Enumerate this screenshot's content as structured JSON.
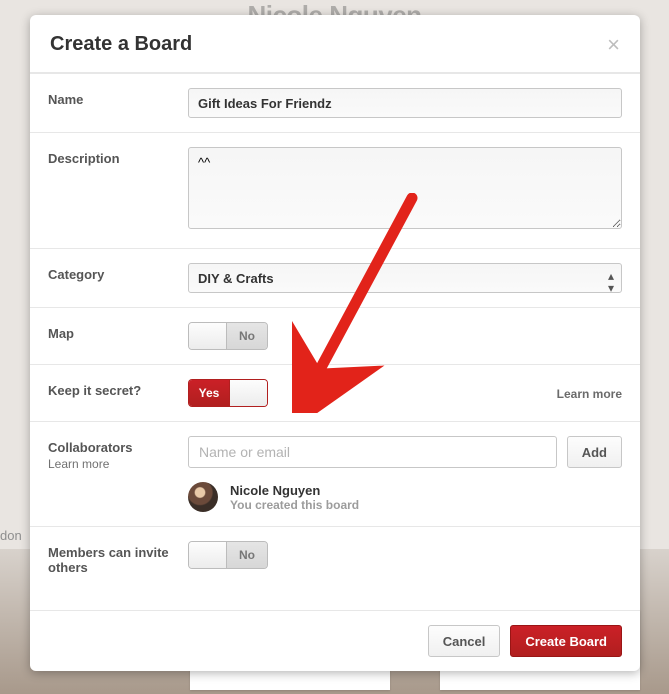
{
  "bg": {
    "name_peek": "Nicole Nguyen",
    "don": "don"
  },
  "modal": {
    "title": "Create a Board",
    "name": {
      "label": "Name",
      "value": "Gift Ideas For Friendz"
    },
    "description": {
      "label": "Description",
      "value": "^^"
    },
    "category": {
      "label": "Category",
      "value": "DIY & Crafts"
    },
    "map": {
      "label": "Map",
      "state_label": "No"
    },
    "secret": {
      "label": "Keep it secret?",
      "state_label": "Yes",
      "learn_more": "Learn more"
    },
    "collaborators": {
      "label": "Collaborators",
      "sub": "Learn more",
      "placeholder": "Name or email",
      "add": "Add",
      "creator_name": "Nicole Nguyen",
      "creator_sub": "You created this board"
    },
    "members": {
      "label": "Members can invite others",
      "state_label": "No"
    },
    "footer": {
      "cancel": "Cancel",
      "create": "Create Board"
    }
  }
}
